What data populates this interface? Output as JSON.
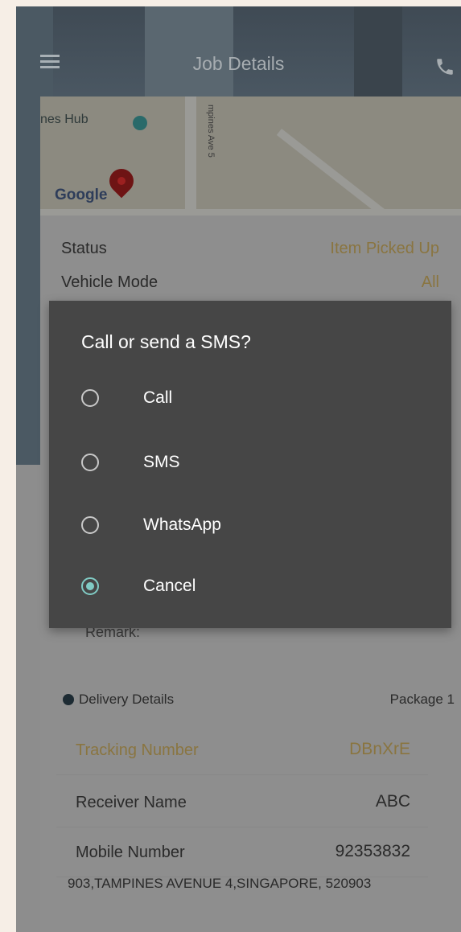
{
  "app_bar": {
    "title": "Job Details",
    "menu_icon": "hamburger-menu-icon",
    "phone_icon": "phone-icon"
  },
  "map": {
    "poi_label": "nes Hub",
    "street_label": "mpines Ave 5",
    "logo": "Google"
  },
  "job_info": {
    "status_label": "Status",
    "status_value": "Item Picked Up",
    "vehicle_label": "Vehicle Mode",
    "vehicle_value": "All"
  },
  "remark_label": "Remark:",
  "delivery": {
    "section_title": "Delivery Details",
    "package_label": "Package 1",
    "rows": [
      {
        "label": "Tracking Number",
        "value": "DBnXrE"
      },
      {
        "label": "Receiver Name",
        "value": "ABC"
      },
      {
        "label": "Mobile Number",
        "value": "92353832"
      }
    ],
    "address": "903,TAMPINES AVENUE 4,SINGAPORE, 520903"
  },
  "dialog": {
    "title": "Call or send a SMS?",
    "options": [
      {
        "label": "Call",
        "checked": false
      },
      {
        "label": "SMS",
        "checked": false
      },
      {
        "label": "WhatsApp",
        "checked": false
      },
      {
        "label": "Cancel",
        "checked": true
      }
    ],
    "accent_color": "#80cbc4"
  },
  "colors": {
    "highlight": "#8a7540",
    "dialog_bg": "#464646"
  }
}
